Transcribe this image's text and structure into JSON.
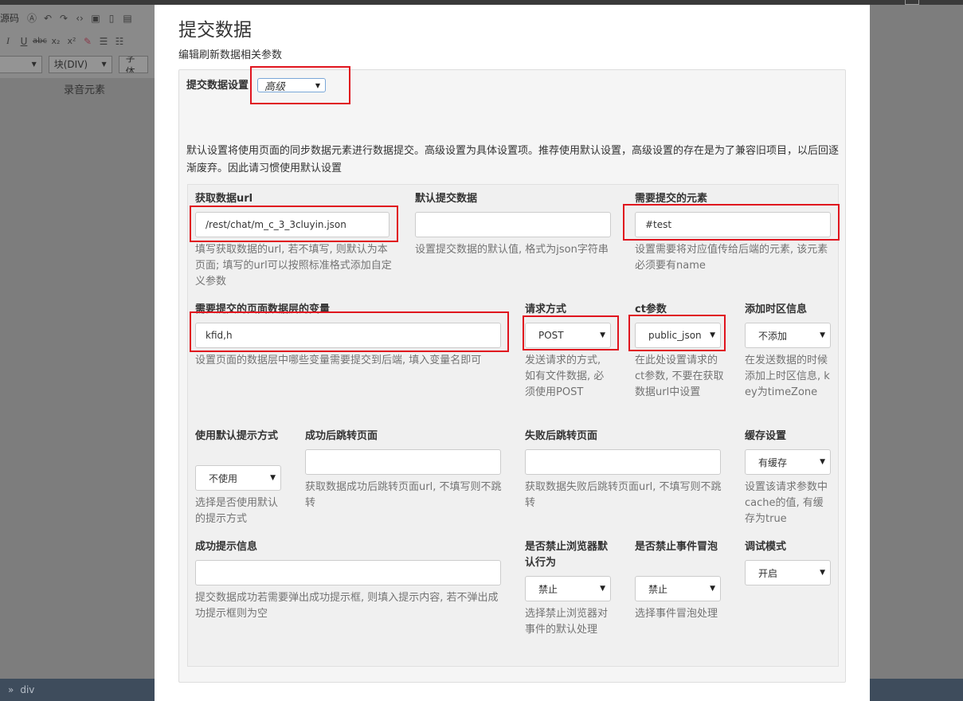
{
  "background": {
    "toolbar": {
      "source_label": "源码",
      "block_select": "块(DIV)",
      "font_select": "字体"
    },
    "canvas_label": "录音元素",
    "status": {
      "separator": "»",
      "path": "div"
    }
  },
  "modal": {
    "title": "提交数据",
    "subtitle": "编辑刷新数据相关参数",
    "settings": {
      "label": "提交数据设置",
      "value": "高级"
    },
    "description": "默认设置将使用页面的同步数据元素进行数据提交。高级设置为具体设置项。推荐使用默认设置，高级设置的存在是为了兼容旧项目，以后回逐渐废弃。因此请习惯使用默认设置",
    "fields": {
      "fetch_url": {
        "label": "获取数据url",
        "value": "/rest/chat/m_c_3_3cluyin.json",
        "help": "填写获取数据的url, 若不填写, 则默认为本页面; 填写的url可以按照标准格式添加自定义参数"
      },
      "default_data": {
        "label": "默认提交数据",
        "value": "",
        "help": "设置提交数据的默认值, 格式为json字符串"
      },
      "elements": {
        "label": "需要提交的元素",
        "value": "#test",
        "help": "设置需要将对应值传给后端的元素, 该元素必须要有name"
      },
      "variables": {
        "label": "需要提交的页面数据层的变量",
        "value": "kfid,h",
        "help": "设置页面的数据层中哪些变量需要提交到后端, 填入变量名即可"
      },
      "method": {
        "label": "请求方式",
        "value": "POST",
        "help": "发送请求的方式, 如有文件数据, 必须使用POST"
      },
      "ct_param": {
        "label": "ct参数",
        "value": "public_json",
        "help": "在此处设置请求的ct参数, 不要在获取数据url中设置"
      },
      "timezone": {
        "label": "添加时区信息",
        "value": "不添加",
        "help": "在发送数据的时候添加上时区信息, key为timeZone"
      },
      "default_prompt": {
        "label": "使用默认提示方式",
        "value": "不使用",
        "help": "选择是否使用默认的提示方式"
      },
      "success_redirect": {
        "label": "成功后跳转页面",
        "value": "",
        "help": "获取数据成功后跳转页面url, 不填写则不跳转"
      },
      "fail_redirect": {
        "label": "失败后跳转页面",
        "value": "",
        "help": "获取数据失败后跳转页面url, 不填写则不跳转"
      },
      "cache": {
        "label": "缓存设置",
        "value": "有缓存",
        "help": "设置该请求参数中cache的值, 有缓存为true"
      },
      "success_message": {
        "label": "成功提示信息",
        "value": "",
        "help": "提交数据成功若需要弹出成功提示框, 则填入提示内容, 若不弹出成功提示框则为空"
      },
      "prevent_default": {
        "label": "是否禁止浏览器默认行为",
        "value": "禁止",
        "help": "选择禁止浏览器对事件的默认处理"
      },
      "stop_propagation": {
        "label": "是否禁止事件冒泡",
        "value": "禁止",
        "help": "选择事件冒泡处理"
      },
      "debug": {
        "label": "调试模式",
        "value": "开启"
      }
    }
  },
  "colors": {
    "highlight": "#e0141e",
    "panel_bg": "#f5f5f5",
    "help_text": "#737373",
    "overlay": "#7d7d7d",
    "statusbar": "#3e4c5c"
  },
  "icons": {
    "dropdown": "chevron-down-icon"
  }
}
